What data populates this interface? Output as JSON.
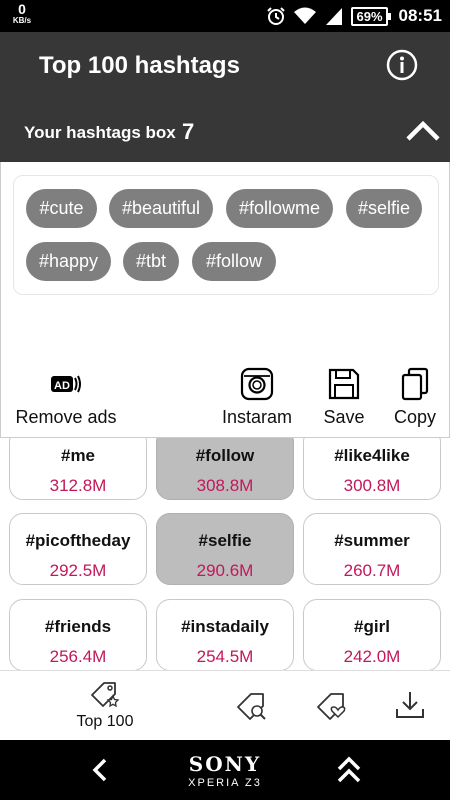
{
  "status_bar": {
    "net_speed": "0",
    "net_unit": "KB/s",
    "battery": "69%",
    "time": "08:51",
    "icons": [
      "alarm-icon",
      "wifi-icon",
      "signal-icon",
      "battery-icon"
    ]
  },
  "header": {
    "title": "Top 100 hashtags",
    "info_icon": "info-icon"
  },
  "hashtag_box": {
    "label": "Your hashtags box",
    "count": "7",
    "chips": [
      "#cute",
      "#beautiful",
      "#followme",
      "#selfie",
      "#happy",
      "#tbt",
      "#follow"
    ]
  },
  "actions": {
    "remove_ads": "Remove ads",
    "instagram": "Instaram",
    "save": "Save",
    "copy": "Copy"
  },
  "hashtags": [
    {
      "tag": "#me",
      "count": "312.8M",
      "selected": false
    },
    {
      "tag": "#follow",
      "count": "308.8M",
      "selected": true
    },
    {
      "tag": "#like4like",
      "count": "300.8M",
      "selected": false
    },
    {
      "tag": "#picoftheday",
      "count": "292.5M",
      "selected": false
    },
    {
      "tag": "#selfie",
      "count": "290.6M",
      "selected": true
    },
    {
      "tag": "#summer",
      "count": "260.7M",
      "selected": false
    },
    {
      "tag": "#friends",
      "count": "256.4M",
      "selected": false
    },
    {
      "tag": "#instadaily",
      "count": "254.5M",
      "selected": false
    },
    {
      "tag": "#girl",
      "count": "242.0M",
      "selected": false
    }
  ],
  "bottom_nav": {
    "top100": "Top 100"
  },
  "system_bar": {
    "brand": "SONY",
    "model": "XPERIA Z3"
  },
  "colors": {
    "header_bg": "#373737",
    "chip_bg": "#7f7f7f",
    "selected_card": "#bdbdbd",
    "count_color": "#c2185b"
  }
}
